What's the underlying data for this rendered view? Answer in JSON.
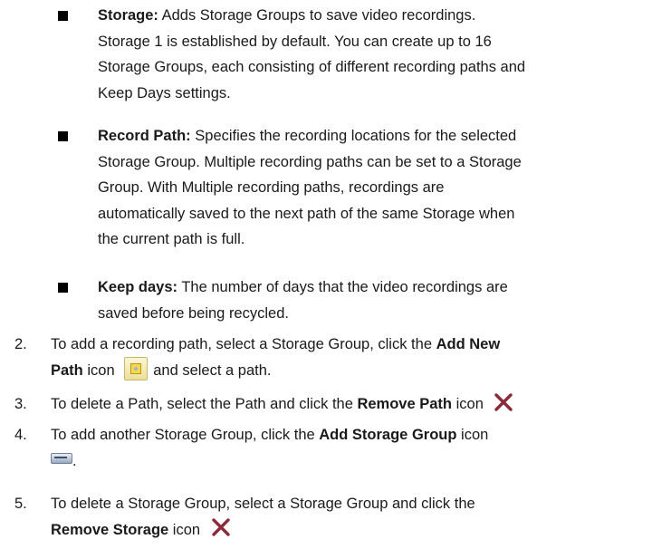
{
  "bullets": [
    {
      "term": "Storage:",
      "lines": [
        " Adds Storage Groups to save video recordings.",
        "Storage 1 is established by default. You can create up to 16",
        "Storage Groups, each consisting of different recording paths and",
        "Keep Days settings."
      ]
    },
    {
      "term": "Record Path:",
      "lines": [
        " Specifies the recording locations for the selected",
        "Storage Group. Multiple recording paths can be set to a Storage",
        "Group. With Multiple recording paths, recordings are",
        "automatically saved to the next path of the same Storage when",
        "the current path is full."
      ]
    },
    {
      "term": "Keep days:",
      "lines": [
        " The number of days that the video recordings are",
        "saved before being recycled."
      ]
    }
  ],
  "steps": [
    {
      "num": "2.",
      "l1a": "To add a recording path, select a Storage Group, click the ",
      "l1b": "Add New",
      "l2a": "Path",
      "l2b": " icon",
      "l2c": "and select a path.",
      "icon": "add-path-icon"
    },
    {
      "num": "3.",
      "a": "To delete a Path, select the Path and click the ",
      "b": "Remove Path",
      "c": " icon",
      "icon": "remove-icon"
    },
    {
      "num": "4.",
      "a": "To add another Storage Group, click the ",
      "b": "Add Storage Group",
      "c": " icon",
      "icon": "add-storage-icon",
      "d": "."
    },
    {
      "num": "5.",
      "l1": "To delete a Storage Group, select a Storage Group and click the",
      "l2b": "Remove Storage",
      "l2c": " icon",
      "icon": "remove-icon"
    }
  ],
  "colors": {
    "text": "#1a1a1a",
    "remove_icon": "#8b2a3a"
  }
}
